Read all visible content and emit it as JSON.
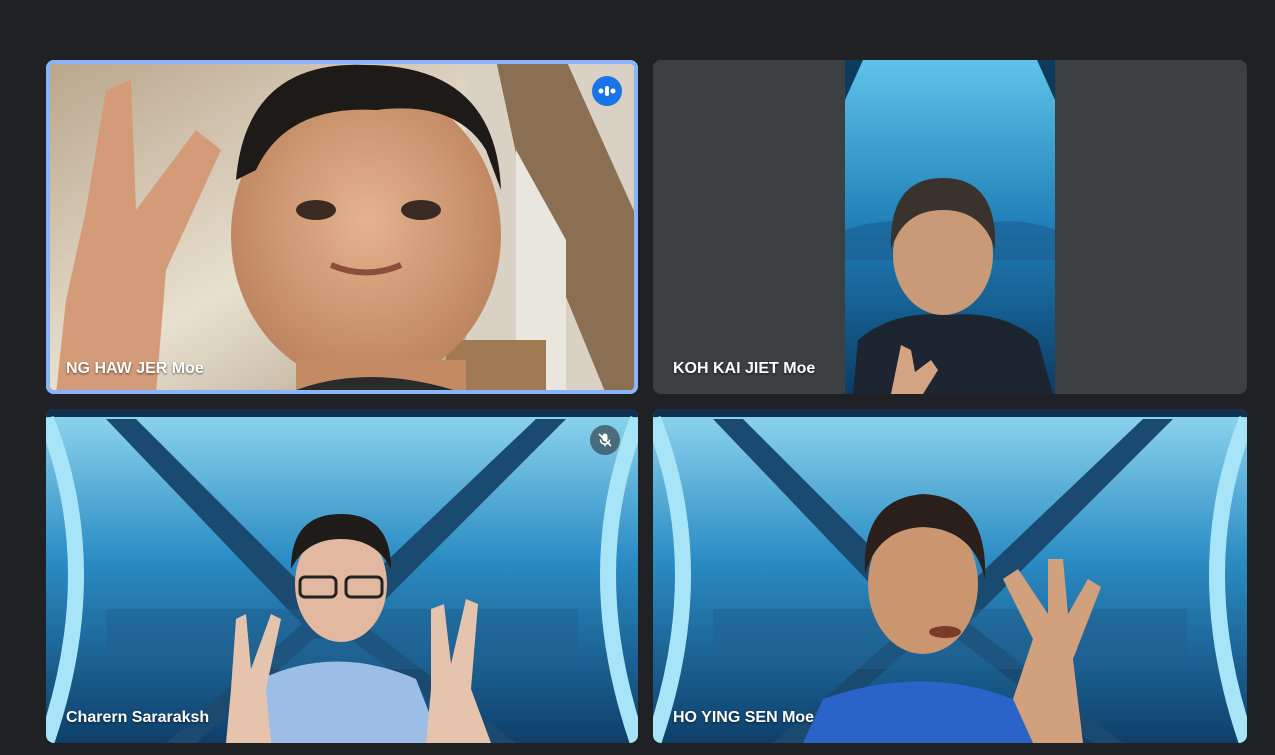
{
  "participants": [
    {
      "name": "NG HAW JER Moe",
      "speaking": true,
      "muted": false
    },
    {
      "name": "KOH KAI JIET Moe",
      "speaking": false,
      "muted": false
    },
    {
      "name": "Charern Sararaksh",
      "speaking": false,
      "muted": true
    },
    {
      "name": "HO YING SEN Moe",
      "speaking": false,
      "muted": false
    }
  ],
  "icons": {
    "speaking": "audio-level-icon",
    "muted": "mic-off-icon"
  },
  "colors": {
    "background": "#202124",
    "tile": "#3c4043",
    "active_speaker_border": "#8ab4f8",
    "speaking_badge": "#1a73e8"
  }
}
